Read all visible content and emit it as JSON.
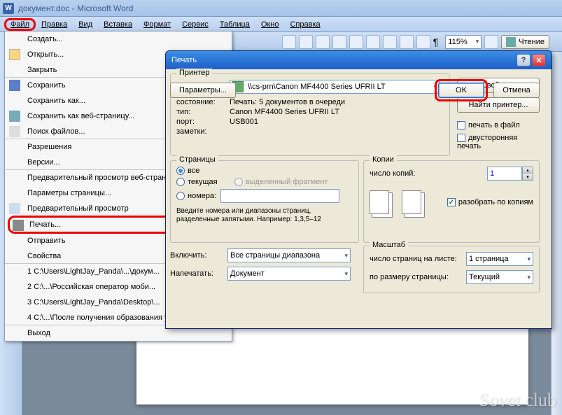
{
  "title": "документ.doc - Microsoft Word",
  "menubar": [
    "Файл",
    "Правка",
    "Вид",
    "Вставка",
    "Формат",
    "Сервис",
    "Таблица",
    "Окно",
    "Справка"
  ],
  "zoom": "115%",
  "reading": "Чтение",
  "file_menu": {
    "items": [
      "Создать...",
      "Открыть...",
      "Закрыть",
      "Сохранить",
      "Сохранить как...",
      "Сохранить как веб-страницу...",
      "Поиск файлов...",
      "Разрешения",
      "Версии...",
      "Предварительный просмотр веб-страницы",
      "Параметры страницы...",
      "Предварительный просмотр",
      "Печать...",
      "Отправить",
      "Свойства",
      "1 C:\\Users\\LightJay_Panda\\...\\докум...",
      "2 C:\\...\\Российская оператор моби...",
      "3 C:\\Users\\LightJay_Panda\\Desktop\\...",
      "4 C:\\...\\После получения образования у ...",
      "Выход"
    ]
  },
  "dlg": {
    "title": "Печать",
    "printer_group": "Принтер",
    "name_lbl": "имя:",
    "printer_name": "\\\\cs-prn\\Canon MF4400 Series UFRII LT",
    "state_lbl": "состояние:",
    "state": "Печать: 5 документов в очереди",
    "type_lbl": "тип:",
    "type": "Canon MF4400 Series UFRII LT",
    "port_lbl": "порт:",
    "port": "USB001",
    "notes_lbl": "заметки:",
    "properties_btn": "Свойства",
    "find_btn": "Найти принтер...",
    "to_file": "печать в файл",
    "duplex": "двусторонняя печать",
    "pages_group": "Страницы",
    "r_all": "все",
    "r_current": "текущая",
    "r_selection": "выделенный фрагмент",
    "r_numbers": "номера:",
    "pages_help": "Введите номера или диапазоны страниц, разделенные запятыми. Например: 1,3,5–12",
    "copies_group": "Копии",
    "copies_lbl": "число копий:",
    "copies_val": "1",
    "collate": "разобрать по копиям",
    "include_lbl": "Включить:",
    "include_val": "Все страницы диапазона",
    "print_lbl": "Напечатать:",
    "print_val": "Документ",
    "scale_group": "Масштаб",
    "pps_lbl": "число страниц на листе:",
    "pps_val": "1 страница",
    "fit_lbl": "по размеру страницы:",
    "fit_val": "Текущий",
    "options_btn": "Параметры...",
    "ok": "OK",
    "cancel": "Отмена"
  },
  "watermark": "Sovet club"
}
